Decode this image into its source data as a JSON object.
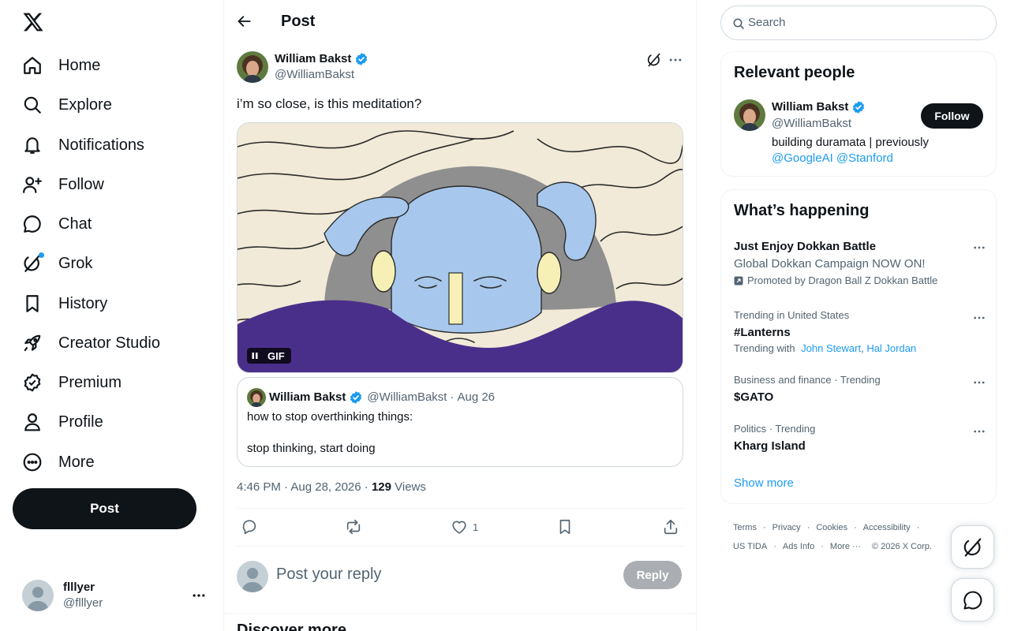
{
  "nav": {
    "items": [
      {
        "label": "Home",
        "icon": "home-icon"
      },
      {
        "label": "Explore",
        "icon": "search-icon"
      },
      {
        "label": "Notifications",
        "icon": "bell-icon"
      },
      {
        "label": "Follow",
        "icon": "person-plus-icon"
      },
      {
        "label": "Chat",
        "icon": "chat-icon"
      },
      {
        "label": "Grok",
        "icon": "grok-icon"
      },
      {
        "label": "History",
        "icon": "bookmark-icon"
      },
      {
        "label": "Creator Studio",
        "icon": "rocket-icon"
      },
      {
        "label": "Premium",
        "icon": "verified-badge-icon"
      },
      {
        "label": "Profile",
        "icon": "person-icon"
      },
      {
        "label": "More",
        "icon": "more-circle-icon"
      }
    ],
    "post_button": "Post",
    "account": {
      "name": "flllyer",
      "handle": "@flllyer"
    }
  },
  "header": {
    "title": "Post"
  },
  "post": {
    "author_name": "William Bakst",
    "author_handle": "@WilliamBakst",
    "text": "i’m so close, is this meditation?",
    "media_badge": "GIF",
    "quote": {
      "name": "William Bakst",
      "handle": "@WilliamBakst",
      "sep": "·",
      "date": "Aug 26",
      "line1": "how to stop overthinking things:",
      "line2": "stop thinking, start doing"
    },
    "timestamp": "4:46 PM · Aug 28, 2026 · ",
    "views_count": "129",
    "views_label": " Views",
    "likes": "1"
  },
  "reply": {
    "placeholder": "Post your reply",
    "button": "Reply"
  },
  "discover_heading": "Discover more",
  "search": {
    "placeholder": "Search"
  },
  "relevant": {
    "title": "Relevant people",
    "name": "William Bakst",
    "handle": "@WilliamBakst",
    "bio_text": "building duramata | previously",
    "bio_links": "@GoogleAI @Stanford",
    "follow": "Follow"
  },
  "happening": {
    "title": "What’s happening",
    "trends": [
      {
        "title": "Just Enjoy Dokkan Battle",
        "subtitle": "Global Dokkan Campaign NOW ON!",
        "promo": "Promoted by Dragon Ball Z Dokkan Battle"
      },
      {
        "context": "Trending in United States",
        "title": "#Lanterns",
        "with_label": "Trending with",
        "with_a": "John Stewart",
        "with_sep": ",",
        "with_b": "Hal Jordan"
      },
      {
        "context": "Business and finance · Trending",
        "title": "$GATO"
      },
      {
        "context": "Politics · Trending",
        "title": "Kharg Island"
      }
    ],
    "show_more": "Show more"
  },
  "footer": {
    "links": [
      "Terms",
      "Privacy",
      "Cookies",
      "Accessibility",
      "US TIDA",
      "Ads Info",
      "More ···",
      "© 2026 X Corp."
    ],
    "sep": "·"
  },
  "colors": {
    "accent": "#1d9bf0",
    "text": "#0f1419",
    "muted": "#536471",
    "border": "#eff3f4"
  }
}
